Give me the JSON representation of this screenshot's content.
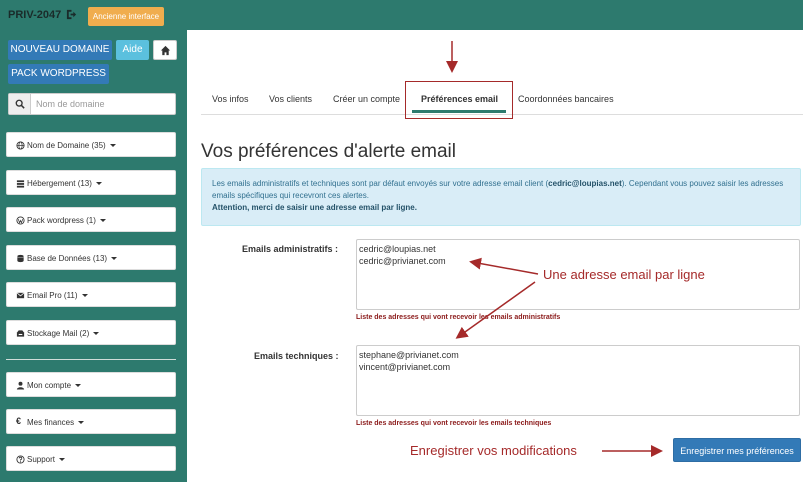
{
  "header": {
    "brand": "PRIV-2047",
    "old_interface_label": "Ancienne interface"
  },
  "sidebar": {
    "new_domain_label": "NOUVEAU DOMAINE",
    "help_label": "Aide",
    "wordpress_pack_label": "PACK WORDPRESS",
    "search_placeholder": "Nom de domaine",
    "items": [
      {
        "label": "Nom de Domaine (35)",
        "icon": "globe-icon"
      },
      {
        "label": "Hébergement (13)",
        "icon": "server-icon"
      },
      {
        "label": "Pack wordpress (1)",
        "icon": "wordpress-icon"
      },
      {
        "label": "Base de Données (13)",
        "icon": "database-icon"
      },
      {
        "label": "Email Pro (11)",
        "icon": "envelope-icon"
      },
      {
        "label": "Stockage Mail (2)",
        "icon": "storage-icon"
      },
      {
        "label": "Mon compte",
        "icon": "user-icon"
      },
      {
        "label": "Mes finances",
        "icon": "euro-icon"
      },
      {
        "label": "Support",
        "icon": "question-icon"
      }
    ]
  },
  "tabs": [
    {
      "label": "Vos infos"
    },
    {
      "label": "Vos clients"
    },
    {
      "label": "Créer un compte"
    },
    {
      "label": "Préférences email",
      "active": true
    },
    {
      "label": "Coordonnées bancaires"
    }
  ],
  "page": {
    "title": "Vos préférences d'alerte email",
    "alert_text_1": "Les emails administratifs et techniques sont par défaut envoyés sur votre adresse email client (",
    "alert_email": "cedric@loupias.net",
    "alert_text_2": "). Cependant vous pouvez saisir les adresses emails spécifiques qui recevront ces alertes.",
    "alert_warning": "Attention, merci de saisir une adresse email par ligne."
  },
  "form": {
    "admin_label": "Emails administratifs :",
    "admin_emails": [
      "cedric@loupias.net",
      "cedric@privianet.com"
    ],
    "admin_help": "Liste des adresses qui vont recevoir les emails administratifs",
    "tech_label": "Emails techniques :",
    "tech_emails": [
      "stephane@privianet.com",
      "vincent@privianet.com"
    ],
    "tech_help": "Liste des adresses qui vont recevoir les emails techniques",
    "save_label": "Enregistrer mes préférences"
  },
  "annotations": {
    "one_per_line": "Une adresse email par ligne",
    "save_changes": "Enregistrer vos modifications",
    "color": "#a52a2a"
  },
  "colors": {
    "brand_green": "#2d7a6e",
    "primary": "#337ab7",
    "info": "#5bc0de",
    "warning": "#f0ad4e"
  }
}
